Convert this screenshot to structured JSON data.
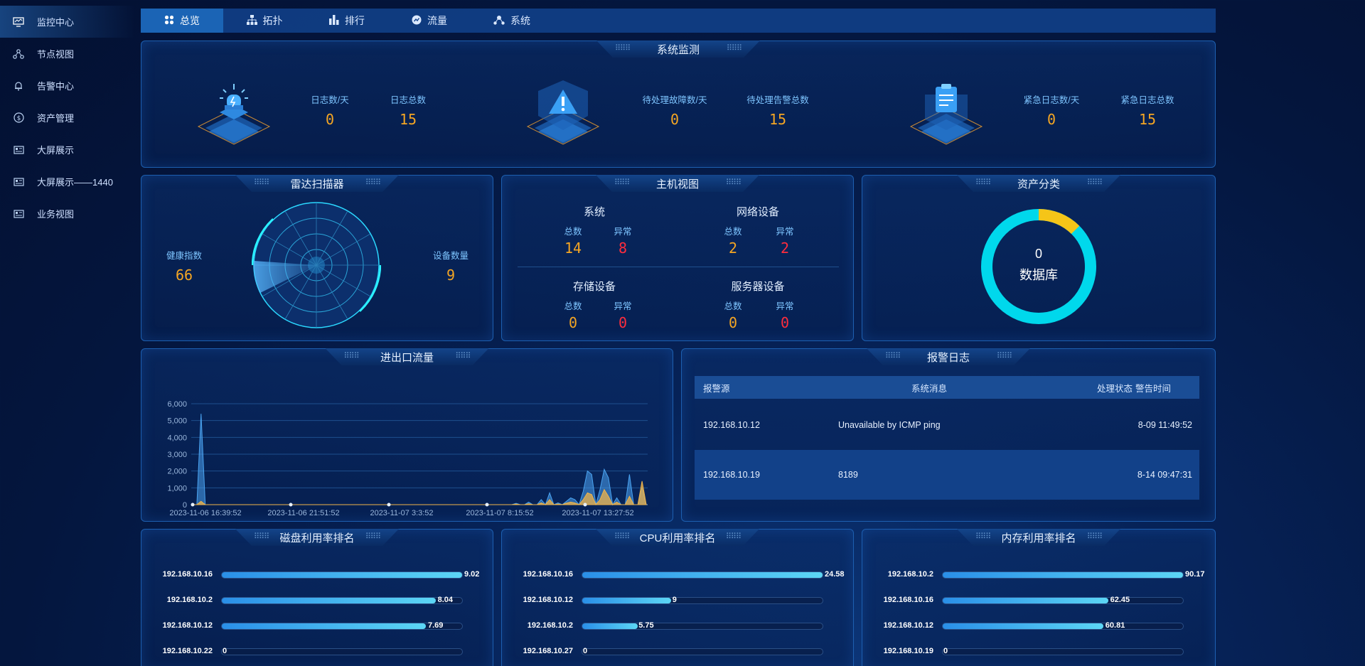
{
  "sidebar": {
    "items": [
      {
        "label": "监控中心",
        "icon": "monitor-icon"
      },
      {
        "label": "节点视图",
        "icon": "nodes-icon"
      },
      {
        "label": "告警中心",
        "icon": "bell-icon"
      },
      {
        "label": "资产管理",
        "icon": "dollar-icon"
      },
      {
        "label": "大屏展示",
        "icon": "screen-icon"
      },
      {
        "label": "大屏展示——1440",
        "icon": "screen-icon"
      },
      {
        "label": "业务视图",
        "icon": "screen-icon"
      }
    ]
  },
  "tabs": [
    {
      "label": "总览",
      "icon": "grid-icon"
    },
    {
      "label": "拓扑",
      "icon": "topology-icon"
    },
    {
      "label": "排行",
      "icon": "bar-chart-icon"
    },
    {
      "label": "流量",
      "icon": "flow-icon"
    },
    {
      "label": "系统",
      "icon": "system-icon"
    }
  ],
  "system_monitor": {
    "title": "系统监测",
    "groups": [
      {
        "a_label": "日志数/天",
        "a_value": "0",
        "b_label": "日志总数",
        "b_value": "15",
        "icon": "alarm-light-icon"
      },
      {
        "a_label": "待处理故障数/天",
        "a_value": "0",
        "b_label": "待处理告警总数",
        "b_value": "15",
        "icon": "warning-icon"
      },
      {
        "a_label": "紧急日志数/天",
        "a_value": "0",
        "b_label": "紧急日志总数",
        "b_value": "15",
        "icon": "clipboard-icon"
      }
    ]
  },
  "radar": {
    "title": "雷达扫描器",
    "health_label": "健康指数",
    "health_value": "66",
    "device_label": "设备数量",
    "device_value": "9"
  },
  "host_view": {
    "title": "主机视图",
    "total_label": "总数",
    "abnormal_label": "异常",
    "groups": [
      {
        "name": "系统",
        "total": "14",
        "abnormal": "8"
      },
      {
        "name": "网络设备",
        "total": "2",
        "abnormal": "2"
      },
      {
        "name": "存储设备",
        "total": "0",
        "abnormal": "0"
      },
      {
        "name": "服务器设备",
        "total": "0",
        "abnormal": "0"
      }
    ]
  },
  "asset": {
    "title": "资产分类",
    "center_value": "0",
    "center_label": "数据库",
    "colors": {
      "main": "#00d8ec",
      "minor": "#f5c518"
    }
  },
  "traffic": {
    "title": "进出口流量",
    "chart_data": {
      "type": "area",
      "y_ticks": [
        "6,000",
        "5,000",
        "4,000",
        "3,000",
        "2,000",
        "1,000",
        "0"
      ],
      "ylim": [
        0,
        6000
      ],
      "x_ticks": [
        "2023-11-06 16:39:52",
        "2023-11-06 21:51:52",
        "2023-11-07 3:3:52",
        "2023-11-07 8:15:52",
        "2023-11-07 13:27:52"
      ],
      "series": [
        {
          "color": "#4aa3f0",
          "values": [
            0,
            0,
            5400,
            0,
            0,
            0,
            0,
            0,
            0,
            0,
            0,
            0,
            0,
            0,
            0,
            0,
            0,
            0,
            0,
            0,
            0,
            0,
            0,
            0,
            0,
            0,
            0,
            0,
            0,
            0,
            0,
            0,
            0,
            0,
            0,
            0,
            0,
            0,
            0,
            0,
            0,
            0,
            0,
            0,
            0,
            0,
            0,
            0,
            0,
            0,
            0,
            0,
            0,
            0,
            0,
            0,
            0,
            0,
            0,
            0,
            0,
            0,
            0,
            0,
            0,
            0,
            0,
            0,
            0,
            0,
            0,
            0,
            0,
            0,
            0,
            0,
            0,
            80,
            0,
            0,
            150,
            0,
            0,
            300,
            0,
            700,
            0,
            100,
            0,
            200,
            400,
            300,
            0,
            800,
            2000,
            1800,
            0,
            900,
            2100,
            1600,
            0,
            400,
            0,
            0,
            1800,
            0,
            0,
            1000,
            0
          ]
        },
        {
          "color": "#f0b44a",
          "values": [
            0,
            0,
            200,
            0,
            0,
            0,
            0,
            0,
            0,
            0,
            0,
            0,
            0,
            0,
            0,
            0,
            0,
            0,
            0,
            0,
            0,
            0,
            0,
            0,
            0,
            0,
            0,
            0,
            0,
            0,
            0,
            0,
            0,
            0,
            0,
            0,
            0,
            0,
            0,
            0,
            0,
            0,
            0,
            0,
            0,
            0,
            0,
            0,
            0,
            0,
            0,
            0,
            0,
            0,
            0,
            0,
            0,
            0,
            0,
            0,
            0,
            0,
            0,
            0,
            0,
            0,
            0,
            0,
            0,
            0,
            0,
            0,
            0,
            0,
            0,
            0,
            0,
            30,
            0,
            0,
            50,
            0,
            0,
            100,
            0,
            300,
            0,
            40,
            0,
            90,
            150,
            100,
            0,
            300,
            700,
            600,
            0,
            300,
            900,
            500,
            0,
            150,
            0,
            0,
            500,
            0,
            0,
            1400,
            0
          ]
        }
      ]
    }
  },
  "alarm_log": {
    "title": "报警日志",
    "headers": [
      "报警源",
      "系统消息",
      "处理状态",
      "警告时间"
    ],
    "rows": [
      {
        "source": "192.168.10.12",
        "message": "Unavailable by ICMP ping",
        "status": "",
        "time": "8-09 11:49:52"
      },
      {
        "source": "192.168.10.19",
        "message": "8189",
        "status": "",
        "time": "8-14 09:47:31"
      }
    ]
  },
  "disk_rank": {
    "title": "磁盘利用率排名",
    "items": [
      {
        "ip": "192.168.10.16",
        "value": "9.02",
        "pct": 100
      },
      {
        "ip": "192.168.10.2",
        "value": "8.04",
        "pct": 89
      },
      {
        "ip": "192.168.10.12",
        "value": "7.69",
        "pct": 85
      },
      {
        "ip": "192.168.10.22",
        "value": "0",
        "pct": 0
      }
    ]
  },
  "cpu_rank": {
    "title": "CPU利用率排名",
    "items": [
      {
        "ip": "192.168.10.16",
        "value": "24.58",
        "pct": 100
      },
      {
        "ip": "192.168.10.12",
        "value": "9",
        "pct": 37
      },
      {
        "ip": "192.168.10.2",
        "value": "5.75",
        "pct": 23
      },
      {
        "ip": "192.168.10.27",
        "value": "0",
        "pct": 0
      }
    ]
  },
  "mem_rank": {
    "title": "内存利用率排名",
    "items": [
      {
        "ip": "192.168.10.2",
        "value": "90.17",
        "pct": 100
      },
      {
        "ip": "192.168.10.16",
        "value": "62.45",
        "pct": 69
      },
      {
        "ip": "192.168.10.12",
        "value": "60.81",
        "pct": 67
      },
      {
        "ip": "192.168.10.19",
        "value": "0",
        "pct": 0
      }
    ]
  }
}
